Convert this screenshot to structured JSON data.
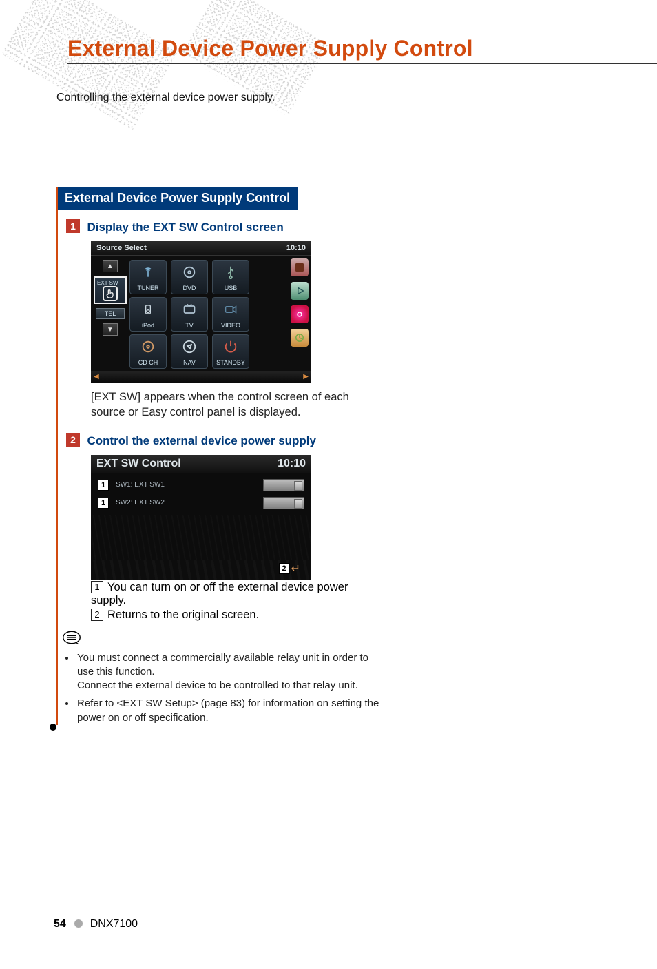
{
  "page": {
    "title": "External Device Power Supply Control",
    "intro": "Controlling the external device power supply.",
    "section_header": "External Device Power Supply Control",
    "step1": {
      "num": "1",
      "title": "Display the EXT SW Control screen",
      "note": "[EXT SW] appears when the control screen of each source or Easy control panel is displayed."
    },
    "step2": {
      "num": "2",
      "title": "Control the external device power supply",
      "callout1": {
        "num": "1",
        "text": "You can turn on or off the external device power supply."
      },
      "callout2": {
        "num": "2",
        "text": "Returns to the original screen."
      }
    },
    "notes": {
      "a_line1": "You must connect a commercially available relay unit in order to use this function.",
      "a_line2": "Connect the external device to be controlled to that relay unit.",
      "b": "Refer to <EXT SW Setup> (page 83) for information on setting the power on or off specification."
    },
    "footer": {
      "page_number": "54",
      "model": "DNX7100"
    }
  },
  "screen1": {
    "title": "Source Select",
    "clock": "10:10",
    "ext_sw_label": "EXT SW",
    "tel_label": "TEL",
    "sources": {
      "tuner": "TUNER",
      "dvd": "DVD",
      "usb": "USB",
      "ipod": "iPod",
      "tv": "TV",
      "video": "VIDEO",
      "cdch": "CD CH",
      "nav": "NAV",
      "standby": "STANDBY"
    }
  },
  "screen2": {
    "title": "EXT SW Control",
    "clock": "10:10",
    "rows": {
      "r1": "SW1: EXT SW1",
      "r2": "SW2: EXT SW2"
    },
    "callouts": {
      "c1": "1",
      "c2": "2"
    }
  }
}
